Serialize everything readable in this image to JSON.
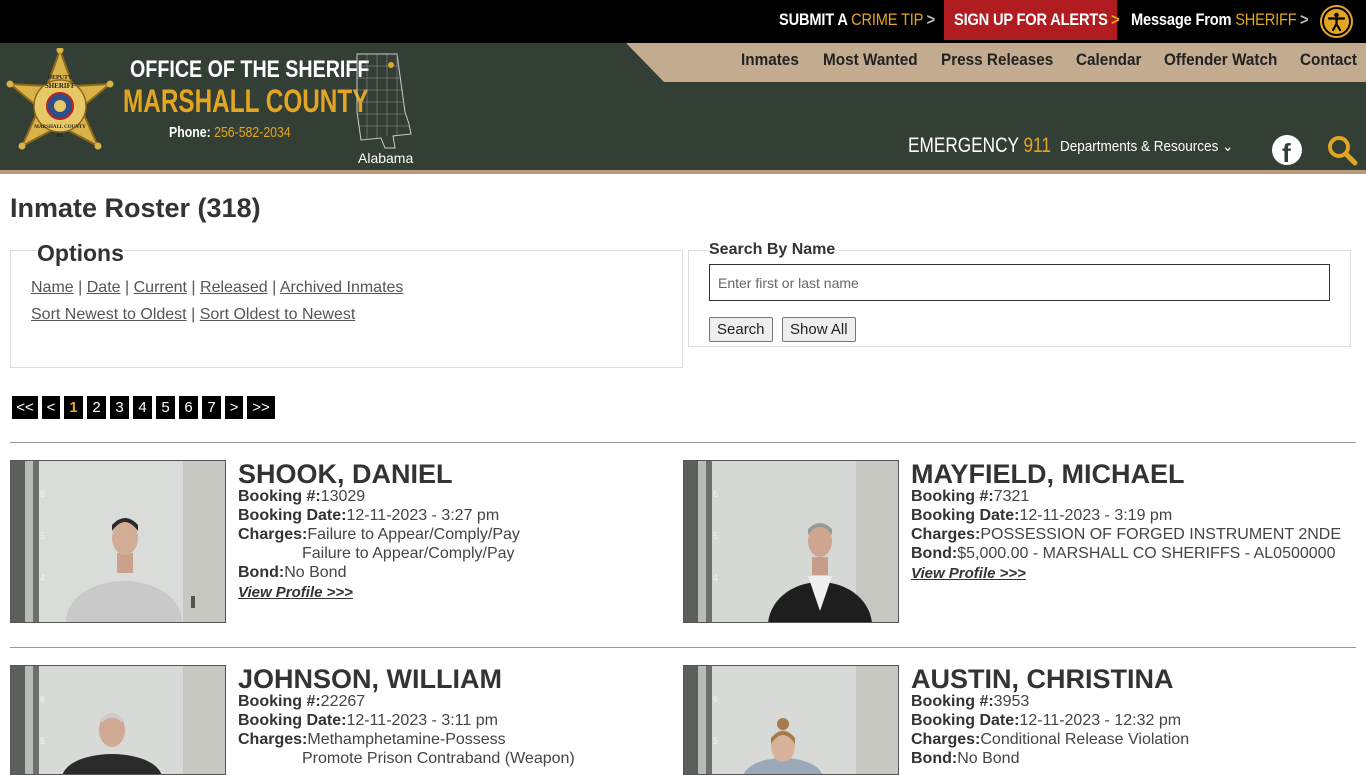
{
  "topbar": {
    "crime_tip": {
      "pre": "SUBMIT A ",
      "gold": "CRIME TIP",
      "arrow": ">"
    },
    "alerts": {
      "label": "SIGN UP FOR ALERTS",
      "arrow": ">"
    },
    "message": {
      "pre": "Message From ",
      "gold": "SHERIFF",
      "arrow": ">"
    },
    "accessibility_icon": "accessibility-icon"
  },
  "header": {
    "office": "OFFICE OF THE SHERIFF",
    "county": "MARSHALL COUNTY",
    "phone_label": "Phone: ",
    "phone": "256-582-2034",
    "state": "Alabama",
    "badge": {
      "top": "DEPUTY",
      "arc": "SHERIFF",
      "bottom": "MARSHALL COUNTY",
      "al": "AL"
    },
    "emergency_label": "EMERGENCY ",
    "emergency_number": "911",
    "departments": "Departments & Resources",
    "nav": [
      "Inmates",
      "Most Wanted",
      "Press Releases",
      "Calendar",
      "Offender Watch",
      "Contact"
    ],
    "colors": {
      "header_bg": "#333e35",
      "gold": "#e3a623",
      "nav_band": "#c2ab8f",
      "alert_red": "#b01c1f"
    }
  },
  "page": {
    "title": "Inmate Roster (318)"
  },
  "options": {
    "legend": "Options",
    "sort_links": [
      "Name",
      "Date",
      "Current",
      "Released",
      "Archived Inmates"
    ],
    "order_links": [
      "Sort Newest to Oldest",
      "Sort Oldest to Newest"
    ],
    "separator": "|"
  },
  "search": {
    "label": "Search By Name",
    "placeholder": "Enter first or last name",
    "search_btn": "Search",
    "show_all_btn": "Show All"
  },
  "pagination": [
    "<<",
    "<",
    "1",
    "2",
    "3",
    "4",
    "5",
    "6",
    "7",
    ">",
    ">>"
  ],
  "current_page": "1",
  "labels": {
    "booking": "Booking #:",
    "booking_date": "Booking Date:",
    "charges": "Charges:",
    "bond": "Bond:",
    "view": "View Profile >>>"
  },
  "inmates": [
    {
      "name": "SHOOK, DANIEL",
      "booking": "13029",
      "date": "12-11-2023 - 3:27 pm",
      "charges": [
        "Failure to Appear/Comply/Pay",
        "Failure to Appear/Comply/Pay"
      ],
      "bond": "No Bond"
    },
    {
      "name": "MAYFIELD, MICHAEL",
      "booking": "7321",
      "date": "12-11-2023 - 3:19 pm",
      "charges": [
        "POSSESSION OF FORGED INSTRUMENT 2NDE"
      ],
      "bond": "$5,000.00 - MARSHALL CO SHERIFFS - AL0500000"
    },
    {
      "name": "JOHNSON, WILLIAM",
      "booking": "22267",
      "date": "12-11-2023 - 3:11 pm",
      "charges": [
        "Methamphetamine-Possess",
        "Promote Prison Contraband (Weapon)"
      ],
      "bond": ""
    },
    {
      "name": "AUSTIN, CHRISTINA",
      "booking": "3953",
      "date": "12-11-2023 - 12:32 pm",
      "charges": [
        "Conditional Release Violation"
      ],
      "bond": "No Bond"
    }
  ]
}
